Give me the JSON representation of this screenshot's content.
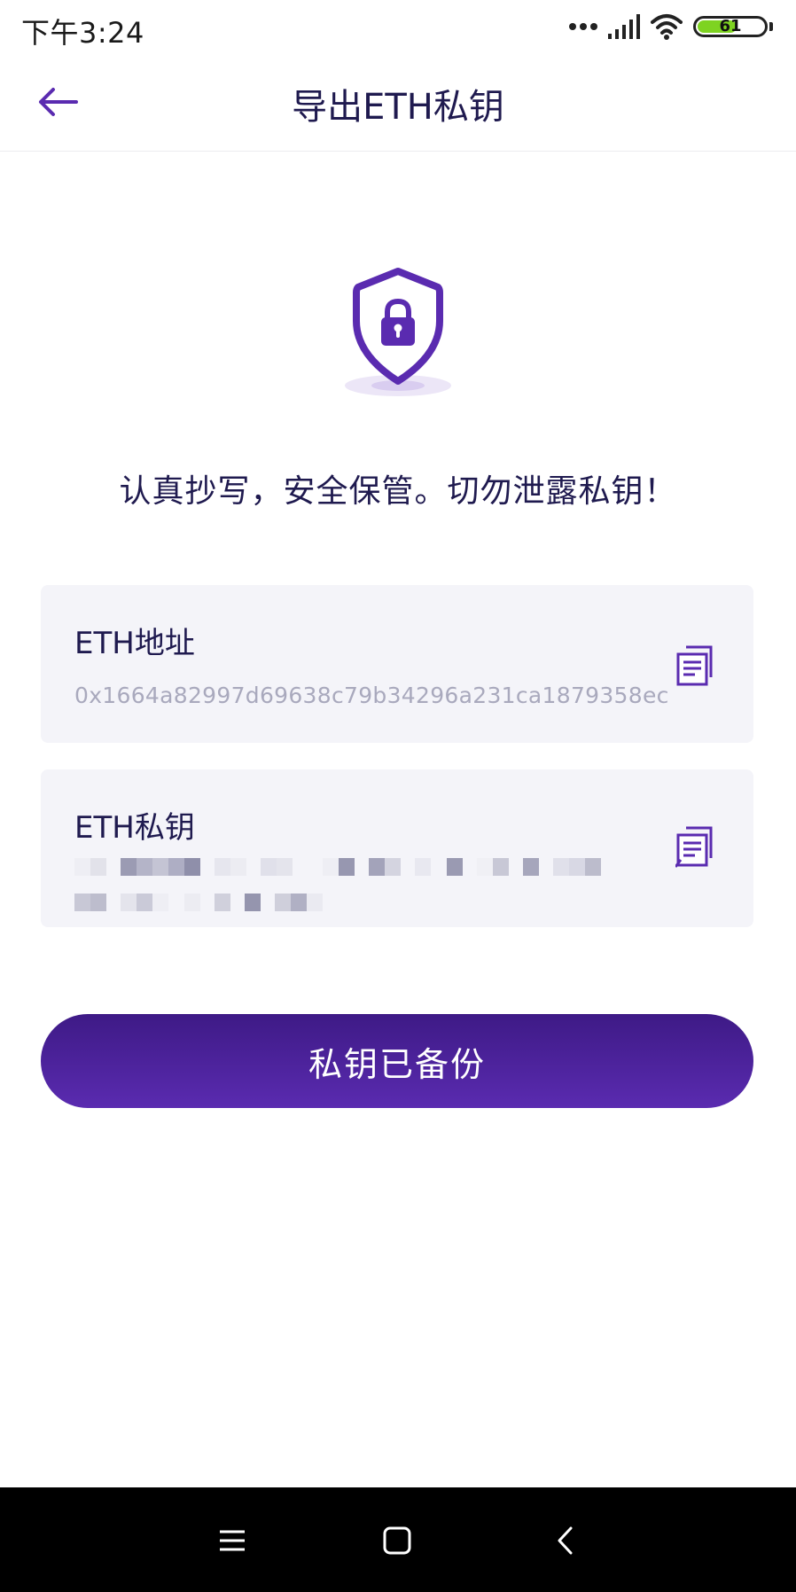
{
  "status_bar": {
    "time": "下午3:24",
    "battery_level": 61,
    "battery_label": "61",
    "icons": [
      "more-dots-icon",
      "signal-icon",
      "wifi-icon",
      "battery-icon"
    ]
  },
  "header": {
    "title": "导出ETH私钥",
    "back_icon": "arrow-left-icon"
  },
  "shield_icon": "shield-lock-icon",
  "warning": "认真抄写，安全保管。切勿泄露私钥！",
  "address_card": {
    "label": "ETH地址",
    "value": "0x1664a82997d69638c79b34296a231ca1879358ec",
    "copy_icon": "copy-icon"
  },
  "key_card": {
    "label": "ETH私钥",
    "value_state": "pixelated",
    "copy_icon": "copy-icon"
  },
  "backup_button": {
    "label": "私钥已备份"
  },
  "nav_bar": {
    "icons": [
      "menu-icon",
      "home-icon",
      "back-icon"
    ]
  },
  "colors": {
    "primary": "#4b22a0",
    "title": "#1f1a4f",
    "card_bg": "#f4f4f9",
    "muted_text": "#a9a9bd"
  }
}
